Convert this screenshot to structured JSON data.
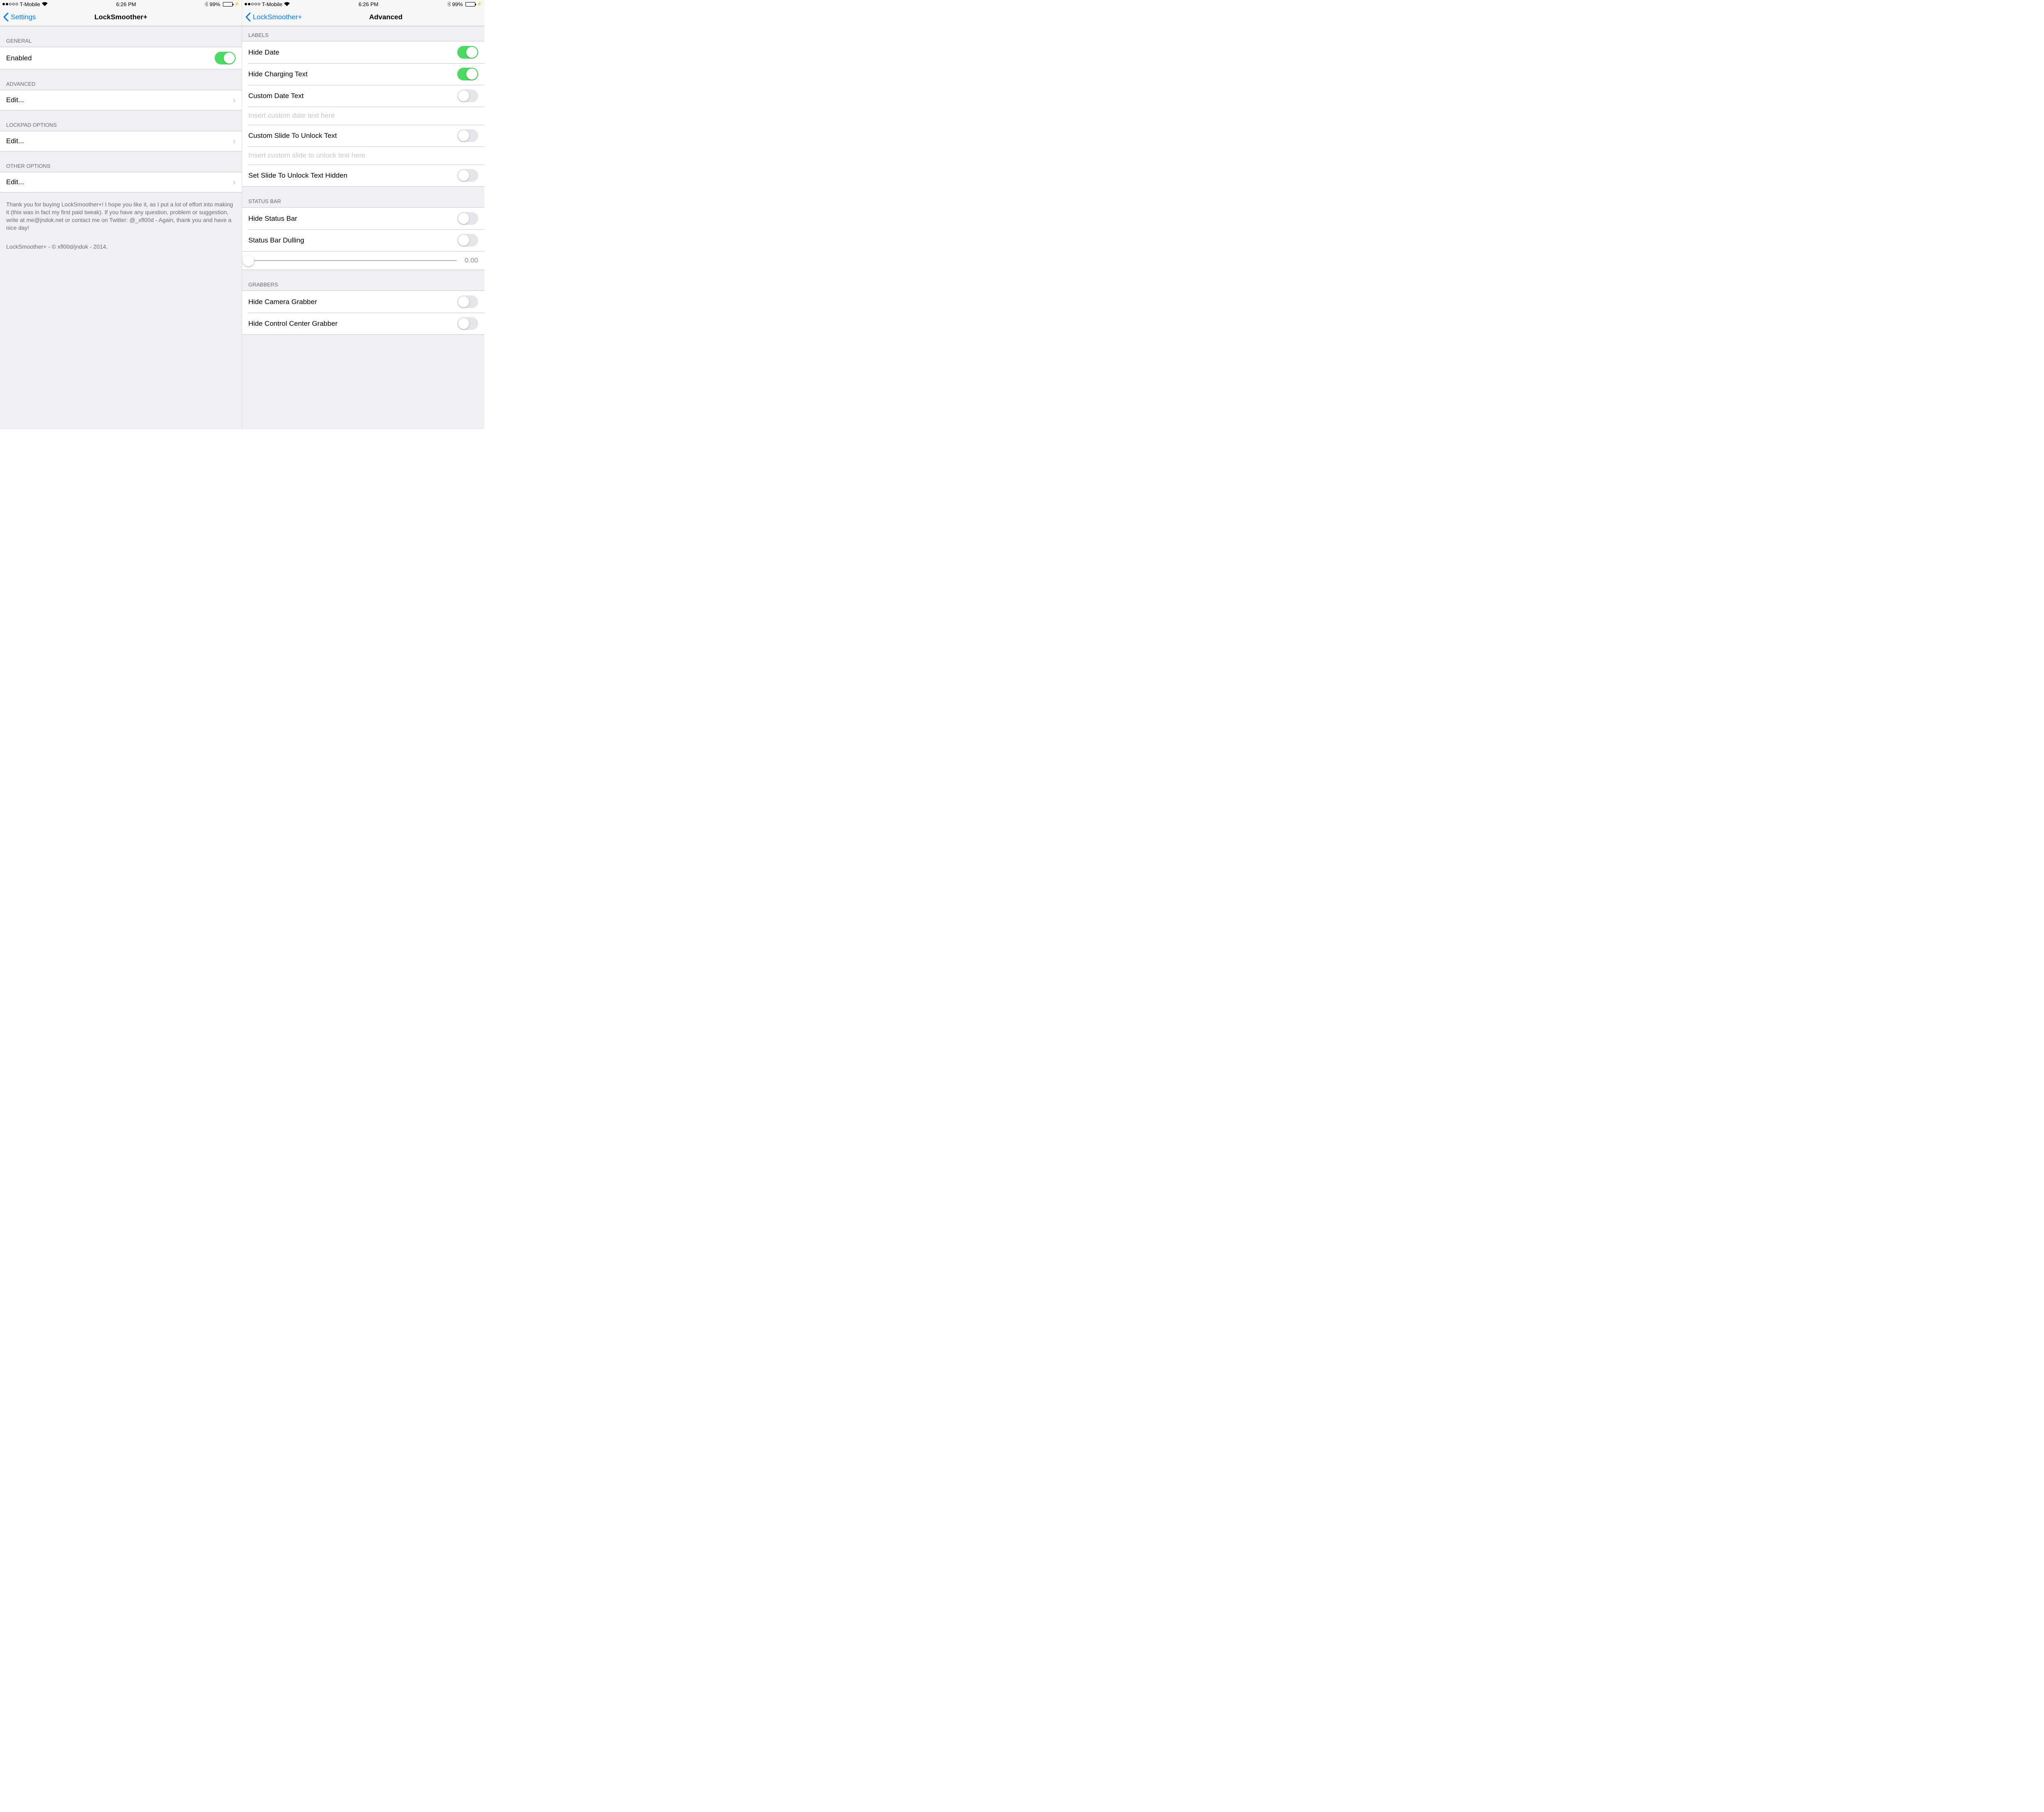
{
  "status_bar": {
    "carrier": "T-Mobile",
    "time": "6:26 PM",
    "battery_pct": "99%",
    "signal_filled": 2,
    "signal_total": 5
  },
  "left": {
    "nav": {
      "back_label": "Settings",
      "title": "LockSmoother+"
    },
    "groups": {
      "general": {
        "header": "GENERAL",
        "enabled_label": "Enabled",
        "enabled_on": true
      },
      "advanced": {
        "header": "ADVANCED",
        "edit_label": "Edit..."
      },
      "lockpad": {
        "header": "LOCKPAD OPTIONS",
        "edit_label": "Edit..."
      },
      "other": {
        "header": "OTHER OPTIONS",
        "edit_label": "Edit..."
      }
    },
    "footer": "Thank you for buying LockSmoother+! I hope you like it, as I put a lot of effort into making it (this was in fact my first paid tweak). If you have any question, problem or suggestion, write at me@jndok.net or contact me on Twitter: @_xfl00d - Again, thank you and have a nice day!",
    "copyright": "LockSmoother+ - © xfl00d/jndok - 2014."
  },
  "right": {
    "nav": {
      "back_label": "LockSmoother+",
      "title": "Advanced"
    },
    "labels": {
      "header": "LABELS",
      "hide_date": {
        "label": "Hide Date",
        "on": true
      },
      "hide_charging": {
        "label": "Hide Charging Text",
        "on": true
      },
      "custom_date": {
        "label": "Custom Date Text",
        "on": false
      },
      "custom_date_placeholder": "Insert custom date text here",
      "custom_slide": {
        "label": "Custom Slide To Unlock Text",
        "on": false
      },
      "custom_slide_placeholder": "Insert custom slide to unlock text here",
      "hide_slide": {
        "label": "Set Slide To Unlock Text Hidden",
        "on": false
      }
    },
    "statusbar": {
      "header": "STATUS BAR",
      "hide_status": {
        "label": "Hide Status Bar",
        "on": false
      },
      "dulling": {
        "label": "Status Bar Dulling",
        "on": false
      },
      "slider_value": "0.00"
    },
    "grabbers": {
      "header": "GRABBERS",
      "hide_camera": {
        "label": "Hide Camera Grabber",
        "on": false
      },
      "hide_cc": {
        "label": "Hide Control Center Grabber",
        "on": false
      }
    }
  }
}
